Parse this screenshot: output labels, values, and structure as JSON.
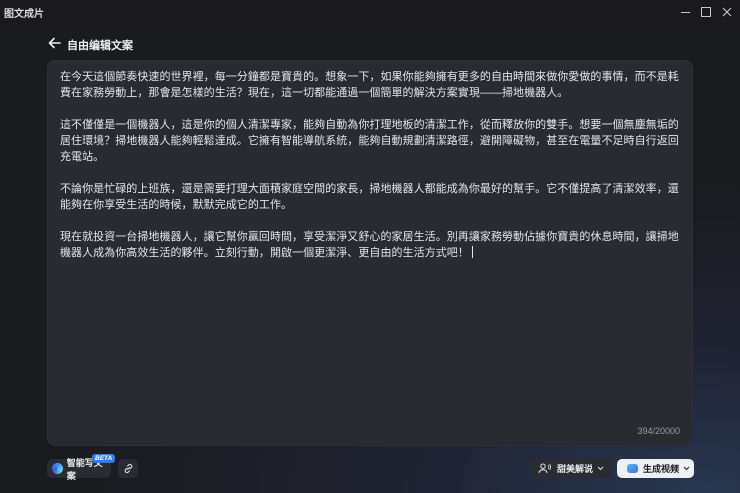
{
  "app": {
    "title": "图文成片"
  },
  "header": {
    "title": "自由编辑文案"
  },
  "editor": {
    "paragraphs": [
      "在今天這個節奏快速的世界裡，每一分鐘都是寶貴的。想象一下，如果你能夠擁有更多的自由時間來做你愛做的事情，而不是耗費在家務勞動上，那會是怎樣的生活？現在，這一切都能通過一個簡單的解決方案實現——掃地機器人。",
      "這不僅僅是一個機器人，這是你的個人清潔專家，能夠自動為你打理地板的清潔工作，從而釋放你的雙手。想要一個無塵無垢的居住環境？掃地機器人能夠輕鬆達成。它擁有智能導航系統，能夠自動規劃清潔路徑，避開障礙物，甚至在電量不足時自行返回充電站。",
      "不論你是忙碌的上班族，還是需要打理大面積家庭空間的家長，掃地機器人都能成為你最好的幫手。它不僅提高了清潔效率，還能夠在你享受生活的時候，默默完成它的工作。",
      "現在就投資一台掃地機器人，讓它幫你贏回時間，享受潔淨又舒心的家居生活。別再讓家務勞動佔據你寶貴的休息時間，讓掃地機器人成為你高效生活的夥伴。立刻行動，開啟一個更潔淨、更自由的生活方式吧！"
    ],
    "char_count": "394/20000"
  },
  "toolbar": {
    "ai_write_label": "智能写文案",
    "beta_badge": "BETA",
    "voice_label": "甜美解说",
    "generate_label": "生成视频"
  },
  "colors": {
    "accent": "#2f7df6",
    "editor_bg": "#2a2b30",
    "primary_button_bg": "#eef0f4"
  },
  "icons": {
    "back": "arrow-left-icon",
    "link": "link-icon",
    "voice": "person-voice-icon",
    "ai": "ai-sparkle-icon",
    "generate": "video-icon"
  }
}
